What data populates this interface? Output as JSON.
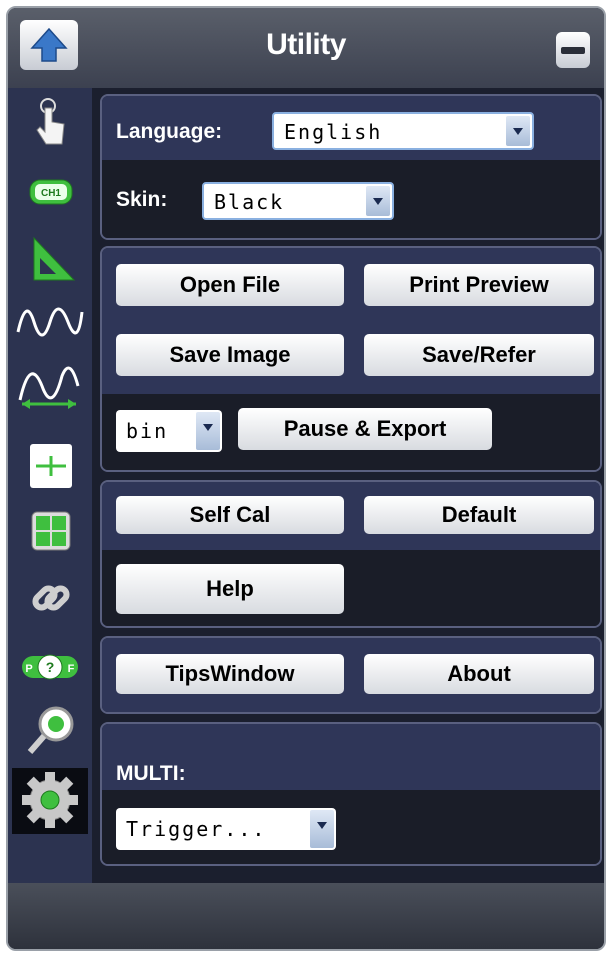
{
  "window": {
    "title": "Utility"
  },
  "sidebar": {
    "icons": [
      "touch-icon",
      "channel-icon",
      "ruler-icon",
      "wave-icon",
      "wave-measure-icon",
      "cursor-icon",
      "calculator-icon",
      "link-icon",
      "pass-fail-icon",
      "zoom-icon",
      "settings-gear-icon"
    ],
    "active": "settings-gear-icon"
  },
  "settings": {
    "language_label": "Language:",
    "language_value": "English",
    "skin_label": "Skin:",
    "skin_value": "Black"
  },
  "file": {
    "open_file": "Open File",
    "print_preview": "Print Preview",
    "save_image": "Save Image",
    "save_refer": "Save/Refer",
    "format_value": "bin",
    "pause_export": "Pause & Export"
  },
  "system": {
    "self_cal": "Self Cal",
    "default": "Default",
    "help": "Help"
  },
  "info": {
    "tips_window": "TipsWindow",
    "about": "About"
  },
  "multi": {
    "label": "MULTI:",
    "value": "Trigger..."
  },
  "colors": {
    "accent": "#2f3658",
    "frame": "#1b1f2e",
    "icon_green": "#3fbf3f",
    "arrow_blue": "#3a78c8"
  }
}
